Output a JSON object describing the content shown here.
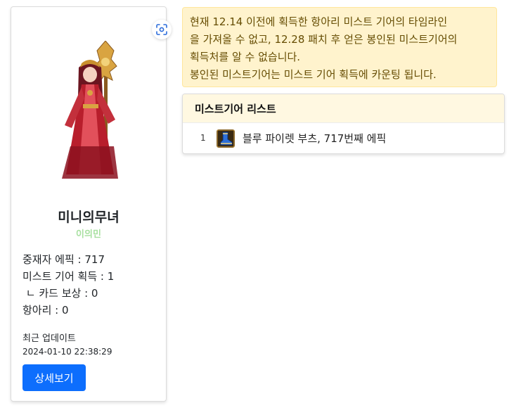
{
  "profile": {
    "character_name": "미니의무녀",
    "guild_name": "이의민",
    "stats": [
      "중재자 에픽 : 717",
      "미스트 기어 획득 : 1",
      " ㄴ 카드 보상 : 0",
      "항아리 : 0"
    ],
    "update_label": "최근 업데이트",
    "update_time": "2024-01-10 22:38:29",
    "detail_button": "상세보기",
    "screenshot_icon": "screenshot-icon",
    "character_image_icon": "character-portrait"
  },
  "notice": {
    "lines": [
      "현재 12.14 이전에 획득한 항아리 미스트 기어의 타임라인",
      "을 가져올 수 없고, 12.28 패치 후 얻은 봉인된 미스트기어의",
      "획득처를 알 수 없습니다.",
      "봉인된 미스트기어는 미스트 기어 획득에 카운팅 됩니다."
    ]
  },
  "mist_gear_list": {
    "title": "미스트기어 리스트",
    "items": [
      {
        "index": "1",
        "name": "블루 파이렛 부츠, 717번째 에픽",
        "icon": "boots-icon"
      }
    ]
  },
  "colors": {
    "primary": "#0d6efd",
    "notice_bg": "#fff3cd",
    "notice_text": "#664d03",
    "guild_green": "#a8e0a0",
    "list_header_bg": "#fff8e1"
  }
}
